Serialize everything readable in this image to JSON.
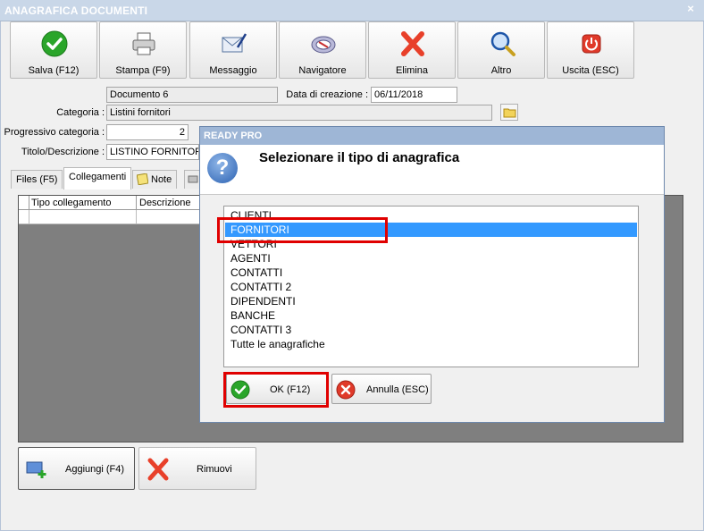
{
  "window": {
    "title": "ANAGRAFICA DOCUMENTI",
    "close": "×"
  },
  "toolbar": [
    {
      "label": "Salva (F12)",
      "icon": "check-icon"
    },
    {
      "label": "Stampa (F9)",
      "icon": "printer-icon"
    },
    {
      "label": "Messaggio",
      "icon": "envelope-pen-icon"
    },
    {
      "label": "Navigatore",
      "icon": "compass-icon"
    },
    {
      "label": "Elimina",
      "icon": "delete-x-icon"
    },
    {
      "label": "Altro",
      "icon": "magnifier-icon"
    },
    {
      "label": "Uscita (ESC)",
      "icon": "power-icon"
    }
  ],
  "form": {
    "documento": "Documento 6",
    "data_label": "Data di creazione :",
    "data_value": "06/11/2018",
    "categoria_label": "Categoria :",
    "categoria_value": "Listini fornitori",
    "progressivo_label": "Progressivo categoria :",
    "progressivo_value": "2",
    "titolo_label": "Titolo/Descrizione :",
    "titolo_value": "LISTINO FORNITORE"
  },
  "tabs": [
    "Files (F5)",
    "Collegamenti",
    "Note"
  ],
  "grid": {
    "columns": [
      "Tipo collegamento",
      "Descrizione"
    ]
  },
  "bottom_buttons": [
    {
      "label": "Aggiungi (F4)",
      "icon": "add-window-icon"
    },
    {
      "label": "Rimuovi",
      "icon": "remove-x-icon"
    }
  ],
  "dialog": {
    "title": "READY PRO",
    "question": "Selezionare il tipo di anagrafica",
    "items": [
      "CLIENTI",
      "FORNITORI",
      "VETTORI",
      "AGENTI",
      "CONTATTI",
      "CONTATTI 2",
      "DIPENDENTI",
      "BANCHE",
      "CONTATTI 3",
      "Tutte le anagrafiche"
    ],
    "selected": "FORNITORI",
    "ok_label": "OK (F12)",
    "cancel_label": "Annulla (ESC)"
  },
  "colors": {
    "highlight": "#e00000",
    "selection": "#3399ff",
    "titlebar": "#c9d7e8"
  }
}
